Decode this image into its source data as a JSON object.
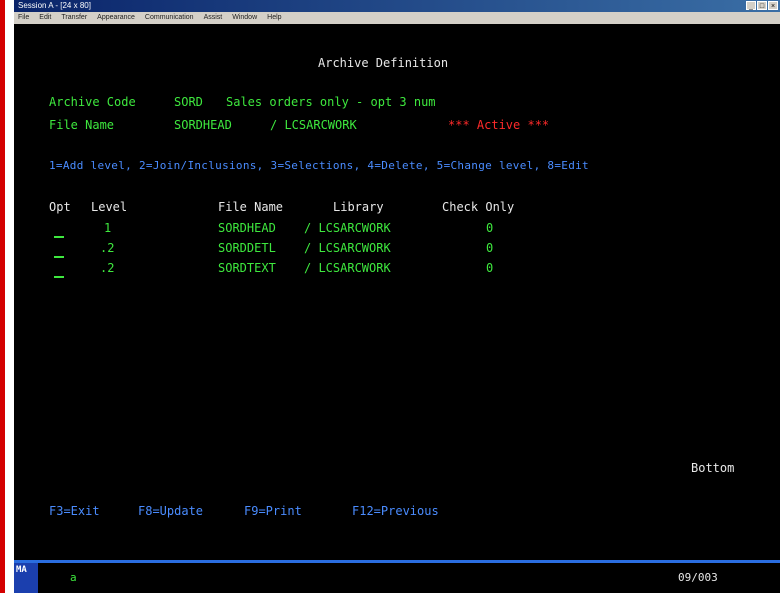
{
  "window": {
    "title": "Session A - [24 x 80]",
    "menu": [
      "File",
      "Edit",
      "Transfer",
      "Appearance",
      "Communication",
      "Assist",
      "Window",
      "Help"
    ]
  },
  "screen": {
    "heading": "Archive Definition",
    "archive_code_label": "Archive Code",
    "archive_code_value": "SORD",
    "archive_desc": "Sales orders only - opt 3 num",
    "file_name_label": "File Name",
    "file_name_value": "SORDHEAD",
    "file_library": "/ LCSARCWORK",
    "active_flag": "*** Active ***",
    "options_line": "1=Add level, 2=Join/Inclusions, 3=Selections, 4=Delete, 5=Change level, 8=Edit",
    "columns": {
      "opt": "Opt",
      "level": "Level",
      "file": "File Name",
      "library": "Library",
      "check": "Check Only"
    },
    "rows": [
      {
        "level": "1",
        "file": "SORDHEAD",
        "library": "/ LCSARCWORK",
        "check": "0"
      },
      {
        "level": ".2",
        "file": "SORDDETL",
        "library": "/ LCSARCWORK",
        "check": "0"
      },
      {
        "level": ".2",
        "file": "SORDTEXT",
        "library": "/ LCSARCWORK",
        "check": "0"
      }
    ],
    "bottom_text": "Bottom",
    "fkeys": {
      "f3": "F3=Exit",
      "f8": "F8=Update",
      "f9": "F9=Print",
      "f12": "F12=Previous"
    }
  },
  "statusbar": {
    "indicator": "MA",
    "field": "a",
    "cursor": "09/003"
  },
  "colors": {
    "field_green": "#3ee83e",
    "text_white": "#e8e8e8",
    "option_blue": "#4a8cff",
    "active_red": "#ff2a2a",
    "statusbar_blue": "#2a6de0"
  }
}
